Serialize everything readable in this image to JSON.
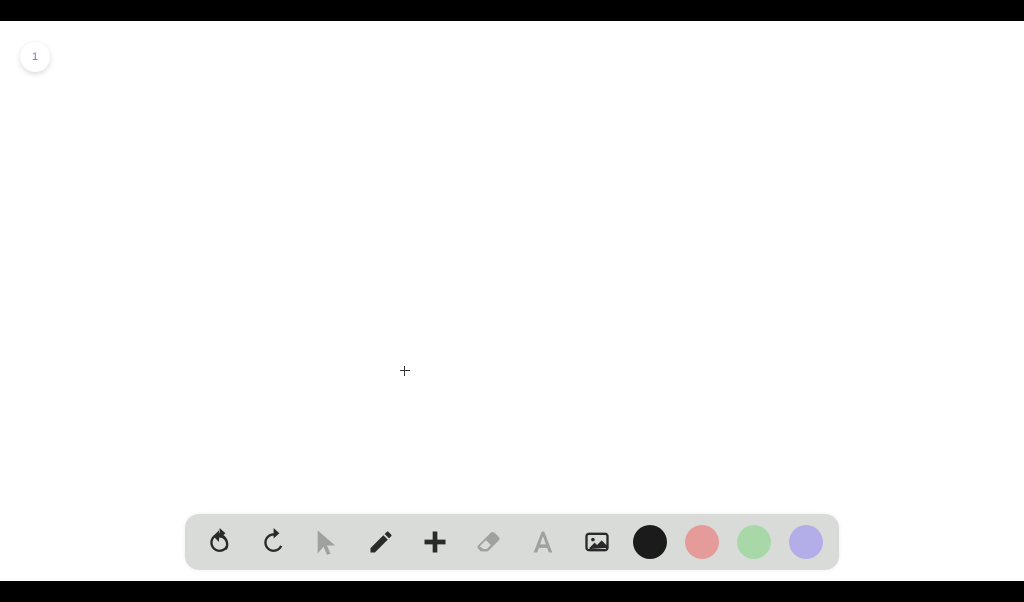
{
  "page_badge": {
    "number": "1"
  },
  "toolbar": {
    "undo_label": "Undo",
    "redo_label": "Redo",
    "pointer_label": "Select",
    "pen_label": "Pen",
    "plus_label": "Add",
    "eraser_label": "Eraser",
    "text_label": "Text",
    "image_label": "Image"
  },
  "colors": {
    "black": "#1b1b1b",
    "red": "#e69b9b",
    "green": "#a8d8a8",
    "purple": "#b3aee8"
  }
}
